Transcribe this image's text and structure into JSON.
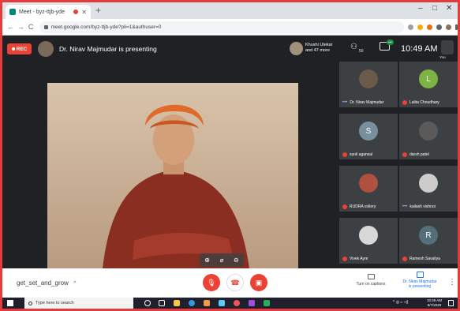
{
  "browser": {
    "tab_title": "Meet - byz-ttjb-yde",
    "new_tab": "+",
    "url": "meet.google.com/byz-ttjb-yde?pli=1&authuser=0",
    "window_controls": [
      "–",
      "□",
      "✕"
    ]
  },
  "meet": {
    "rec_label": "REC",
    "presenting_text": "Dr. Nirav Majmudar is presenting",
    "people_text_line1": "Khushi Utekar",
    "people_text_line2": "and 47 more",
    "people_count": "50",
    "clock": "10:49 AM",
    "self_label": "You"
  },
  "tiles": [
    {
      "name": "Dr. Nirav Majmudar",
      "initial": "",
      "color": "#6b5a4a",
      "muted": false
    },
    {
      "name": "Lalita Choudhary",
      "initial": "L",
      "color": "#7cb342",
      "muted": true
    },
    {
      "name": "sunil agarwal",
      "initial": "S",
      "color": "#78909c",
      "muted": true
    },
    {
      "name": "darsh patel",
      "initial": "",
      "color": "#5a5a5a",
      "muted": true
    },
    {
      "name": "RUDRA vollery",
      "initial": "",
      "color": "#b05040",
      "muted": true
    },
    {
      "name": "kailash vishnoi",
      "initial": "",
      "color": "#cccccc",
      "muted": false
    },
    {
      "name": "Vivek Ayre",
      "initial": "",
      "color": "#d8d8d8",
      "muted": true
    },
    {
      "name": "Ramesh Savaliya",
      "initial": "R",
      "color": "#546e7a",
      "muted": true
    }
  ],
  "bottombar": {
    "meeting_name": "get_set_and_grow",
    "caret": "^",
    "captions_label": "Turn on captions",
    "presenting_label_1": "Dr. Nirav Majmudar",
    "presenting_label_2": "is presenting",
    "more": "⋮"
  },
  "taskbar": {
    "search_placeholder": "Type here to search",
    "tray_time": "10:49 AM",
    "tray_date": "8/7/2020"
  },
  "colors": {
    "accent": "#1a73e8",
    "danger": "#ea4335",
    "background": "#202124"
  }
}
